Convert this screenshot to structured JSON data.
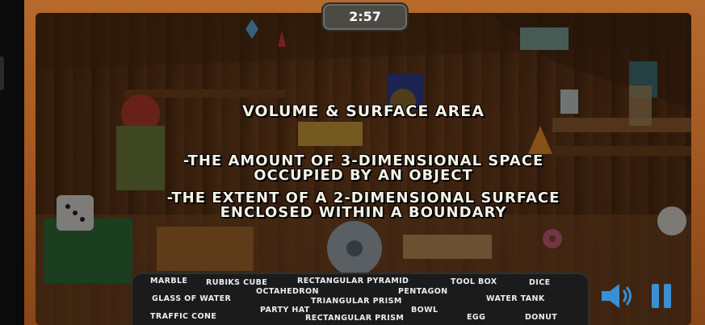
{
  "timer": {
    "value": "2:57"
  },
  "lesson": {
    "title": "VOLUME & SURFACE AREA",
    "lines": [
      "-THE AMOUNT OF 3-DIMENSIONAL SPACE",
      "OCCUPIED BY AN OBJECT",
      "-THE EXTENT OF A 2-DIMENSIONAL SURFACE",
      "ENCLOSED WITHIN A BOUNDARY"
    ]
  },
  "items_to_find": [
    "MARBLE",
    "RUBIKS CUBE",
    "RECTANGULAR PYRAMID",
    "TOOL BOX",
    "DICE",
    "OCTAHEDRON",
    "PENTAGON",
    "GLASS OF WATER",
    "TRIANGULAR PRISM",
    "WATER TANK",
    "PARTY HAT",
    "BOWL",
    "TRAFFIC CONE",
    "RECTANGULAR PRISM",
    "EGG",
    "DONUT"
  ],
  "controls": {
    "sound_icon": "speaker-icon",
    "pause_icon": "pause-icon"
  },
  "colors": {
    "frame": "#a35a24",
    "panel": "#1b1b1b",
    "text": "#f4f1e6",
    "icon_blue": "#3a8fd0"
  }
}
